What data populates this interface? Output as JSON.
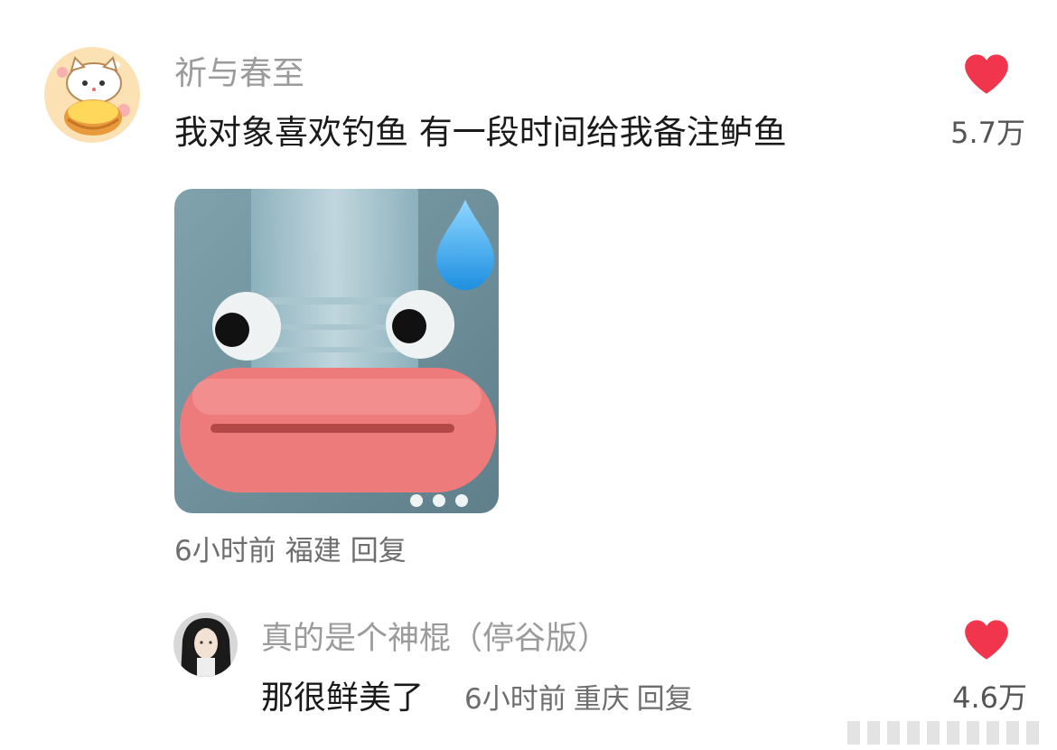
{
  "comments": [
    {
      "username": "祈与春至",
      "text": "我对象喜欢钓鱼 有一段时间给我备注鲈鱼",
      "likes": "5.7万",
      "time": "6小时前",
      "location": "福建",
      "reply_label": "回复",
      "avatar_icon": "cartoon-cat-tart-avatar",
      "image_icon": "bottle-lips-meme"
    },
    {
      "username": "真的是个神棍（停谷版）",
      "text": "那很鲜美了",
      "likes": "4.6万",
      "time": "6小时前",
      "location": "重庆",
      "reply_label": "回复",
      "avatar_icon": "anime-character-avatar"
    }
  ],
  "colors": {
    "heart": "#f0354c",
    "username": "#9b9b9b",
    "text": "#1a1a1a",
    "meta": "#6e6e6e"
  }
}
